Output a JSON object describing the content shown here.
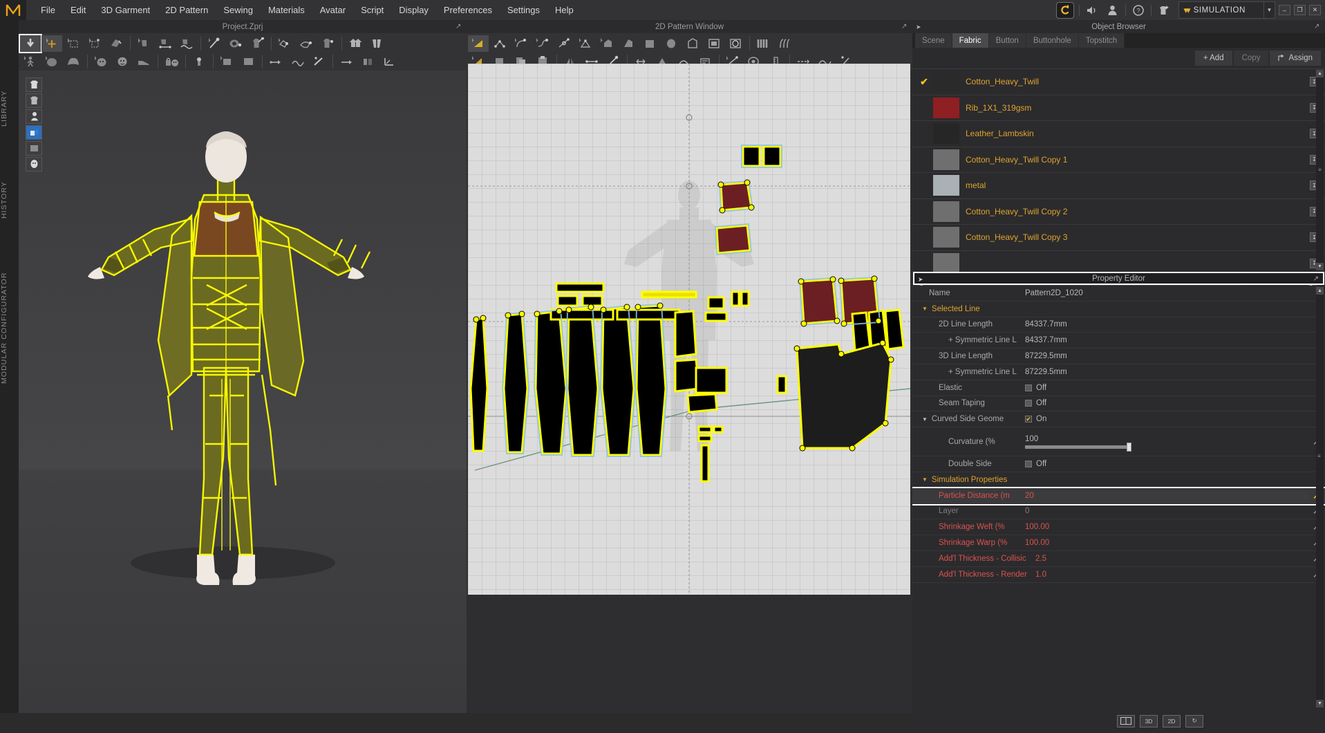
{
  "app": {
    "logo": "M",
    "menu": [
      "File",
      "Edit",
      "3D Garment",
      "2D Pattern",
      "Sewing",
      "Materials",
      "Avatar",
      "Script",
      "Display",
      "Preferences",
      "Settings",
      "Help"
    ],
    "mode_label": "SIMULATION",
    "window_buttons": [
      "–",
      "❐",
      "✕"
    ],
    "top_icons": [
      "clo-logo-icon",
      "sound-icon",
      "avatar-icon",
      "help-icon",
      "garment-add-icon"
    ]
  },
  "left_strip": {
    "tabs": [
      "LIBRARY",
      "HISTORY",
      "MODULAR CONFIGURATOR"
    ]
  },
  "window_3d": {
    "title": "Project.Zprj",
    "tools_row1": [
      "select-mesh-tool",
      "transform-tool",
      "rectangle-select-tool",
      "free-select-tool",
      "fold-arrange-tool",
      "segment-sewing-tool",
      "free-sewing-tool",
      "curve-sewing-tool",
      "pin-tool",
      "tack-tool",
      "fold-tool",
      "edit-x-ray-tool",
      "flatten-tool",
      "inflate-tool",
      "zipper-tool",
      "button-tool",
      "buttonhole-tool",
      "topstitch-tool",
      "measure-tape-tool",
      "ruler-tool"
    ],
    "tools_row2": [
      "pose-tool",
      "avatar-tool",
      "hair-tool",
      "skin-tool",
      "face-tool",
      "shoes-tool",
      "bag-tool",
      "light-tool",
      "camera-tool",
      "trim-tool",
      "gizmo-tool",
      "symmetric-tool",
      "fitting-tool",
      "mirror-tool",
      "grade-tool"
    ],
    "left_tools": [
      "show-garment-icon",
      "show-pattern-icon",
      "show-avatar-icon",
      "show-texture-icon",
      "show-shadow-icon",
      "show-head-icon"
    ]
  },
  "window_2d": {
    "title": "2D Pattern Window",
    "tools_row1": [
      "polygon-tool",
      "point-edit-tool",
      "curve-point-tool",
      "edit-curve-tool",
      "add-point-tool",
      "trace-tool",
      "polygon-shape-tool",
      "rectangle-shape-tool",
      "circle-shape-tool",
      "inner-polygon-tool",
      "inner-rectangle-tool",
      "inner-circle-tool",
      "pleat-tool",
      "dart-tool"
    ],
    "tools_row2": [
      "segment-sewing-tool",
      "free-sewing-tool",
      "copy-tool",
      "paste-tool",
      "flip-tool",
      "sewing-line-tool",
      "pin-tool",
      "grain-line-tool",
      "notch-tool",
      "fold-tool",
      "annotation-tool",
      "measure-tool",
      "baseline-tool",
      "internal-line-tool"
    ]
  },
  "object_browser": {
    "title": "Object Browser",
    "tabs": [
      {
        "label": "Scene",
        "active": false
      },
      {
        "label": "Fabric",
        "active": true
      },
      {
        "label": "Button",
        "active": false
      },
      {
        "label": "Buttonhole",
        "active": false
      },
      {
        "label": "Topstitch",
        "active": false
      }
    ],
    "actions": [
      {
        "label": "+ Add",
        "enabled": true
      },
      {
        "label": "Copy",
        "enabled": false
      },
      {
        "label": "Assign",
        "enabled": true
      }
    ],
    "fabrics": [
      {
        "name": "Cotton_Heavy_Twill",
        "checked": true,
        "swatch": "#2a2a2a"
      },
      {
        "name": "Rib_1X1_319gsm",
        "checked": false,
        "swatch": "#8e1f22"
      },
      {
        "name": "Leather_Lambskin",
        "checked": false,
        "swatch": "#262626"
      },
      {
        "name": "Cotton_Heavy_Twill Copy 1",
        "checked": false,
        "swatch": "#6f6f6f"
      },
      {
        "name": "metal",
        "checked": false,
        "swatch": "#a9b0b6"
      },
      {
        "name": "Cotton_Heavy_Twill Copy 2",
        "checked": false,
        "swatch": "#6f6f6f"
      },
      {
        "name": "Cotton_Heavy_Twill Copy 3",
        "checked": false,
        "swatch": "#6f6f6f"
      }
    ]
  },
  "property_editor": {
    "title": "Property Editor",
    "name_label": "Name",
    "name_value": "Pattern2D_1020",
    "groups": [
      {
        "label": "Selected Line",
        "rows": [
          {
            "label": "2D Line Length",
            "value": "84337.7mm",
            "indent": 1,
            "type": "text"
          },
          {
            "label": "+ Symmetric Line L",
            "value": "84337.7mm",
            "indent": 2,
            "type": "text"
          },
          {
            "label": "3D Line Length",
            "value": "87229.5mm",
            "indent": 1,
            "type": "text"
          },
          {
            "label": "+ Symmetric Line L",
            "value": "87229.5mm",
            "indent": 2,
            "type": "text"
          },
          {
            "label": "Elastic",
            "value": "Off",
            "indent": 1,
            "type": "checkbox",
            "checked": false
          },
          {
            "label": "Seam Taping",
            "value": "Off",
            "indent": 1,
            "type": "checkbox",
            "checked": false
          },
          {
            "label": "Curved Side Geome",
            "value": "On",
            "indent": 0,
            "type": "checkbox-group",
            "checked": true
          },
          {
            "label": "Curvature (%",
            "value": "100",
            "indent": 2,
            "type": "slider",
            "slider_pct": 100
          },
          {
            "label": "Double Side",
            "value": "Off",
            "indent": 1,
            "type": "checkbox",
            "checked": false
          }
        ]
      },
      {
        "label": "Simulation Properties",
        "rows": [
          {
            "label": "Particle Distance (m",
            "value": "20",
            "indent": 1,
            "type": "wrench",
            "highlight": true,
            "color": "red"
          },
          {
            "label": "Layer",
            "value": "0",
            "indent": 1,
            "type": "wrench",
            "color": "dim"
          },
          {
            "label": "Shrinkage Weft (%",
            "value": "100.00",
            "indent": 1,
            "type": "wrench",
            "color": "red"
          },
          {
            "label": "Shrinkage Warp (%",
            "value": "100.00",
            "indent": 1,
            "type": "wrench",
            "color": "red"
          },
          {
            "label": "Add'l Thickness - Collisic",
            "value": "2.5",
            "indent": 1,
            "type": "wrench",
            "color": "red"
          },
          {
            "label": "Add'l Thickness - Render",
            "value": "1.0",
            "indent": 1,
            "type": "wrench",
            "color": "red"
          }
        ]
      }
    ],
    "bottom_buttons": [
      "split-view-icon",
      "3D",
      "2D",
      "reset-view-icon"
    ]
  },
  "colors": {
    "accent_orange": "#e0a32e",
    "highlight_yellow": "#f0c419",
    "red_value": "#d9534f",
    "panel_bg": "#2b2b2d",
    "pattern_yellow": "#ffff00",
    "pattern_dark_red": "#6b1f22"
  }
}
